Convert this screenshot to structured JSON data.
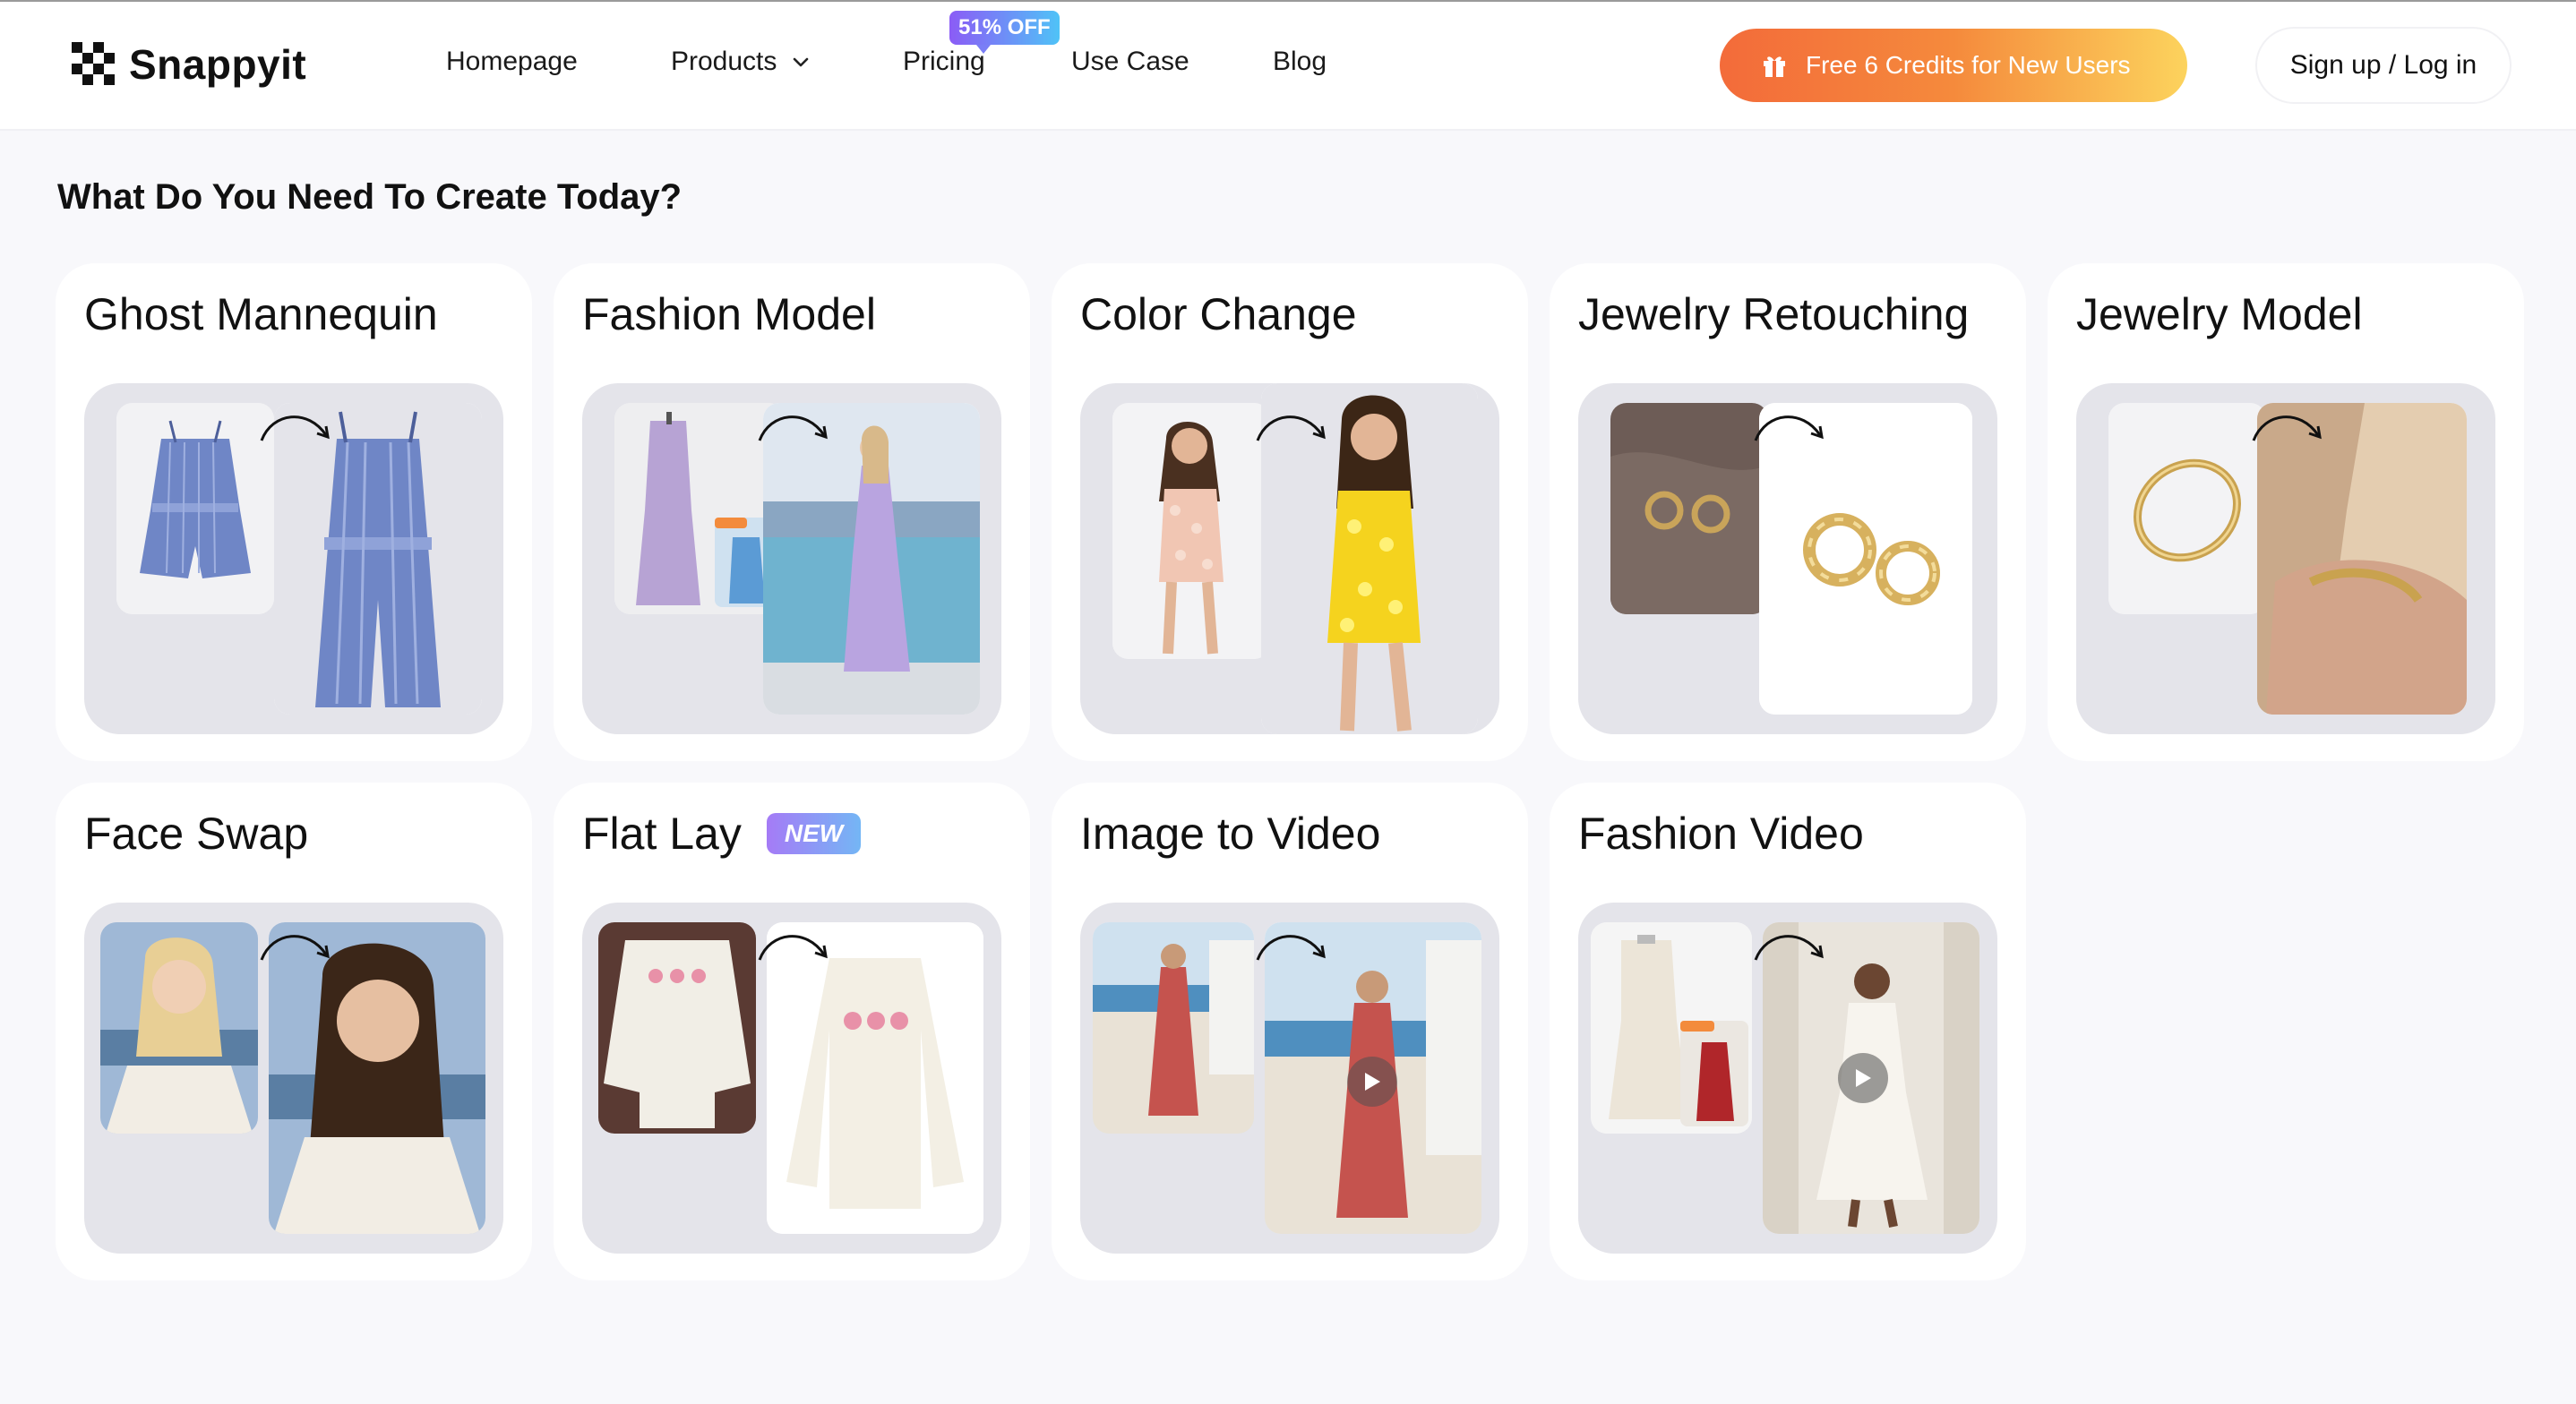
{
  "brand": {
    "name": "Snappyit"
  },
  "nav": {
    "homepage": "Homepage",
    "products": "Products",
    "pricing": "Pricing",
    "pricing_badge": "51% OFF",
    "use_case": "Use Case",
    "blog": "Blog"
  },
  "promo": {
    "label": "Free 6 Credits for New Users"
  },
  "auth": {
    "label": "Sign up / Log in"
  },
  "section": {
    "title": "What Do You Need To Create Today?"
  },
  "cards": [
    {
      "title": "Ghost Mannequin"
    },
    {
      "title": "Fashion Model"
    },
    {
      "title": "Color Change"
    },
    {
      "title": "Jewelry Retouching"
    },
    {
      "title": "Jewelry Model"
    },
    {
      "title": "Face Swap"
    },
    {
      "title": "Flat Lay",
      "badge": "NEW"
    },
    {
      "title": "Image to Video"
    },
    {
      "title": "Fashion Video"
    }
  ],
  "colors": {
    "accent_orange": "#f36b3a",
    "accent_yellow": "#fcd35d",
    "badge_purple": "#8b5cf6",
    "card_preview_bg": "#e4e4ea"
  },
  "icons": [
    "logo-icon",
    "chevron-down-icon",
    "gift-icon",
    "arrow-icon",
    "play-icon"
  ]
}
